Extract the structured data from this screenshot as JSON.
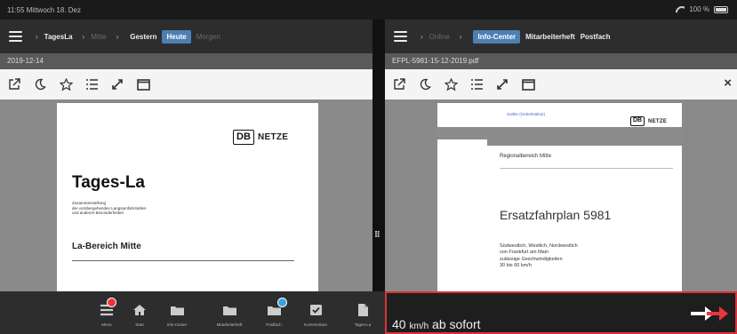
{
  "status": {
    "time": "11:55  Mittwoch 18. Dez",
    "battery": "100 %"
  },
  "left_pane": {
    "breadcrumbs": [
      "TagesLa",
      "Mitte"
    ],
    "tabs": [
      {
        "label": "Gestern",
        "state": "normal"
      },
      {
        "label": "Heute",
        "state": "active"
      },
      {
        "label": "Morgen",
        "state": "dim"
      }
    ],
    "path": "2019-12-14",
    "document": {
      "logo_box": "DB",
      "logo_text": "NETZE",
      "title": "Tages-La",
      "subtitle_lines": [
        "Zusammenstellung",
        "der vorübergehenden Langsamfahrstellen",
        "und anderen Besonderheiten"
      ],
      "section": "La-Bereich Mitte"
    }
  },
  "right_pane": {
    "breadcrumbs": [
      "Online"
    ],
    "tabs": [
      {
        "label": "Info-Center",
        "state": "active"
      },
      {
        "label": "Mitarbeiterheft",
        "state": "normal"
      },
      {
        "label": "Postfach",
        "state": "normal"
      }
    ],
    "path": "EFPL-5981-15-12-2019.pdf",
    "close_label": "×",
    "document": {
      "header_link": "Suttler (Gebelmähne)",
      "logo_box": "DB",
      "logo_text": "NETZE",
      "region": "Regionalbereich Mitte",
      "title": "Ersatzfahrplan 5981",
      "lines": [
        "Südwestlich, Westlich, Nordwestlich",
        "von Frankfurt am Main",
        "zulässige Geschwindigkeiten",
        "30 bis 60 km/h"
      ]
    }
  },
  "divider_handle": "⠿",
  "bottom_nav": [
    {
      "label": "Menü",
      "icon": "menu-icon",
      "badge": "red"
    },
    {
      "label": "Start",
      "icon": "home-icon",
      "badge": ""
    },
    {
      "label": "Info-Center",
      "icon": "folder-icon",
      "badge": ""
    },
    {
      "label": "Mitarbeiterheft",
      "icon": "folder-icon",
      "badge": ""
    },
    {
      "label": "Postfach",
      "icon": "folder-icon",
      "badge": "blue"
    },
    {
      "label": "Kommentare",
      "icon": "check-icon",
      "badge": ""
    },
    {
      "label": "Tages-La",
      "icon": "document-icon",
      "badge": ""
    }
  ],
  "alert": {
    "value": "40",
    "unit": "km/h",
    "text": "ab sofort",
    "icon": "arrow-right-icon"
  },
  "colors": {
    "accent": "#4d7fb3",
    "alert_border": "#d9333a",
    "arrow": "#e8373a"
  }
}
